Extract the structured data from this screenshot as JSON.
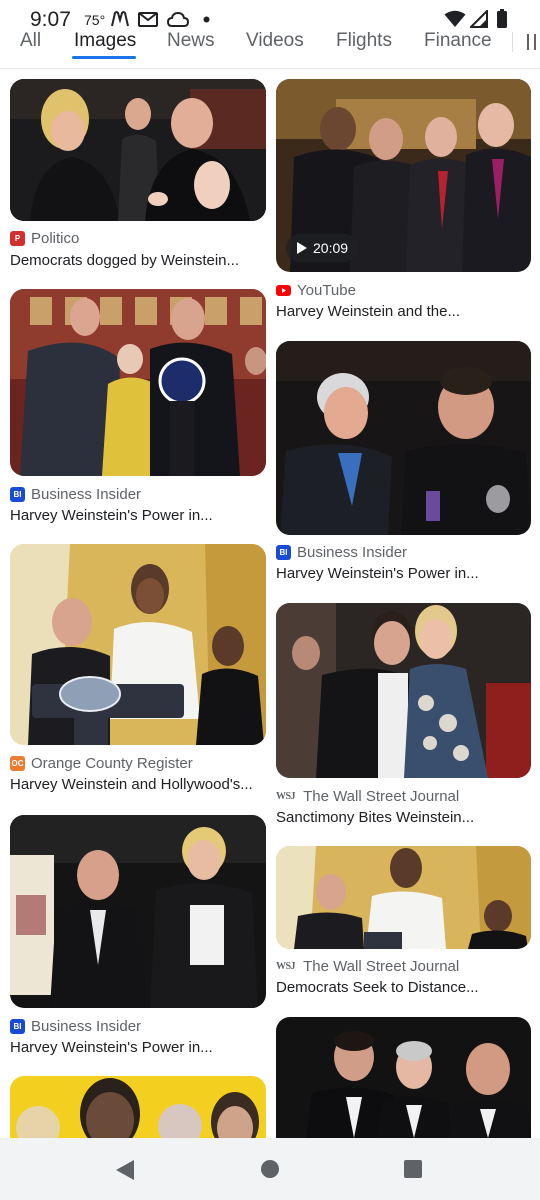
{
  "status_bar": {
    "time": "9:07",
    "temperature": "75°",
    "notifications": [
      "mcdonalds-icon",
      "gmail-icon",
      "cloud-icon",
      "dot-icon"
    ],
    "system": [
      "wifi-icon",
      "signal-icon",
      "battery-icon"
    ]
  },
  "tabs": [
    "All",
    "Images",
    "News",
    "Videos",
    "Flights",
    "Finance"
  ],
  "active_tab": "Images",
  "colors": {
    "accent": "#1a73e8",
    "politico": "#d32f2f",
    "youtube": "#ff0000",
    "business_insider": "#1a4bd6",
    "ocregister": "#ec7c30",
    "text": "#202124",
    "secondary": "#5f6368"
  },
  "results_left": [
    {
      "source": "Politico",
      "favicon": "P",
      "title": "Democrats dogged by Weinstein..."
    },
    {
      "source": "Business Insider",
      "favicon": "BI",
      "title": "Harvey Weinstein's Power in..."
    },
    {
      "source": "Orange County Register",
      "favicon": "OC",
      "title": "Harvey Weinstein and Hollywood's..."
    },
    {
      "source": "Business Insider",
      "favicon": "BI",
      "title": "Harvey Weinstein's Power in..."
    }
  ],
  "results_right": [
    {
      "source": "YouTube",
      "favicon": "youtube-icon",
      "title": "Harvey Weinstein and the...",
      "duration": "20:09"
    },
    {
      "source": "Business Insider",
      "favicon": "BI",
      "title": "Harvey Weinstein's Power in..."
    },
    {
      "source": "The Wall Street Journal",
      "favicon": "WSJ",
      "title": "Sanctimony Bites Weinstein..."
    },
    {
      "source": "The Wall Street Journal",
      "favicon": "WSJ",
      "title": "Democrats Seek to Distance..."
    }
  ],
  "nav": [
    "back-icon",
    "home-icon",
    "recents-icon"
  ]
}
